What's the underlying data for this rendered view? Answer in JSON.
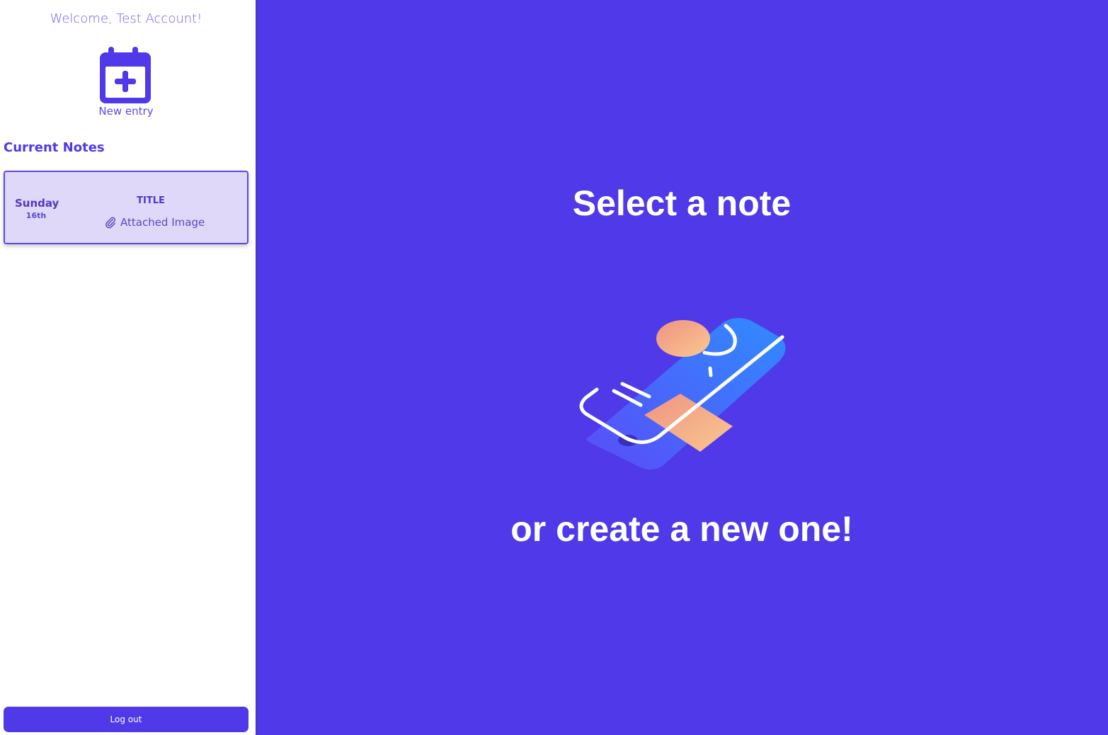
{
  "sidebar": {
    "welcome": "Welcome, Test Account!",
    "new_entry_label": "New entry",
    "new_entry_icon": "calendar-plus-icon",
    "section_title": "Current Notes",
    "notes": [
      {
        "day": "Sunday",
        "date": "16th",
        "title": "TITLE",
        "attachment_icon": "paperclip-icon",
        "attachment_label": "Attached Image"
      }
    ],
    "logout_label": "Log out"
  },
  "main": {
    "headline": "Select a note",
    "subline": "or create a new one!",
    "illustration": "phone-illustration"
  },
  "colors": {
    "accent": "#4f39e8",
    "card_bg": "#dfd8f8",
    "text_on_accent": "#ffffff"
  }
}
